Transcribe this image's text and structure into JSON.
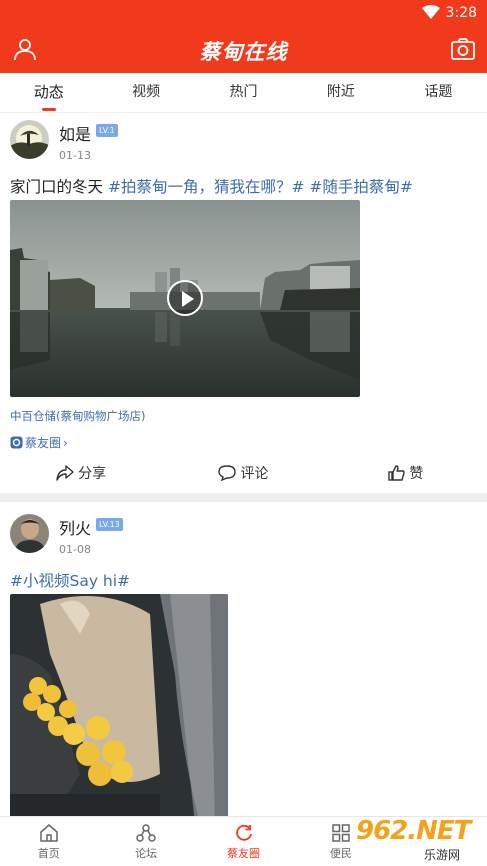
{
  "status_bar": {
    "time": "3:28",
    "wifi_icon": "wifi-icon"
  },
  "app_bar": {
    "title": "蔡甸在线",
    "left_icon": "profile-icon",
    "right_icon": "camera-icon"
  },
  "tabs": [
    {
      "label": "动态",
      "active": true
    },
    {
      "label": "视频",
      "active": false
    },
    {
      "label": "热门",
      "active": false
    },
    {
      "label": "附近",
      "active": false
    },
    {
      "label": "话题",
      "active": false
    }
  ],
  "posts": [
    {
      "username": "如是",
      "level": "LV.1",
      "date": "01-13",
      "text_plain": "家门口的冬天",
      "text_tags": "#拍蔡甸一角，猜我在哪？# #随手拍蔡甸#",
      "media": "video",
      "location": "中百仓储(蔡甸购物广场店)",
      "circle": "蔡友圈",
      "actions": {
        "share": "分享",
        "comment": "评论",
        "like": "赞"
      }
    },
    {
      "username": "列火",
      "level": "LV.13",
      "date": "01-08",
      "text_tags": "#小视频Say hi#",
      "media": "video"
    }
  ],
  "bottom_nav": [
    {
      "label": "首页",
      "icon": "home-icon",
      "active": false
    },
    {
      "label": "论坛",
      "icon": "forum-icon",
      "active": false
    },
    {
      "label": "蔡友圈",
      "icon": "refresh-circle-icon",
      "active": true
    },
    {
      "label": "便民",
      "icon": "grid-icon",
      "active": false
    }
  ],
  "watermark": {
    "big": "962.NET",
    "small": "乐游网"
  },
  "colors": {
    "brand": "#f13a1b",
    "link": "#3d6db0",
    "level_badge": "#7aa8ec"
  }
}
